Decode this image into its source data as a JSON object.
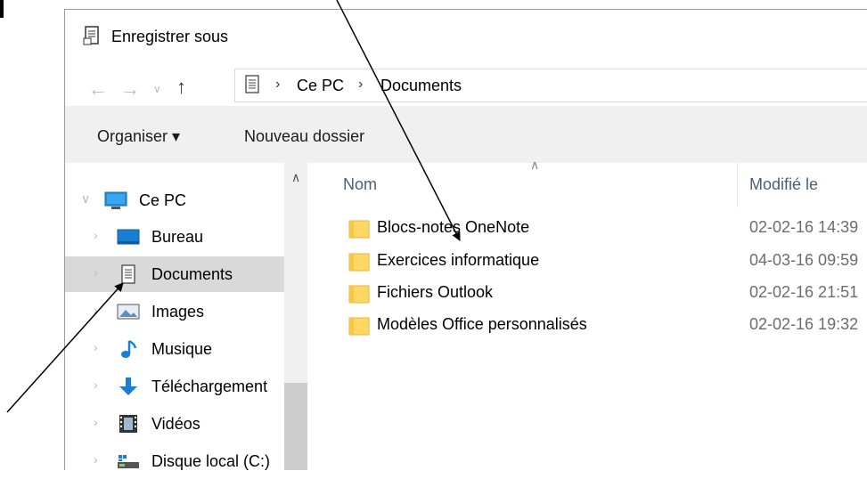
{
  "window": {
    "title": "Enregistrer sous",
    "title_icon": "document-save-icon"
  },
  "address": {
    "back_icon": "back-arrow-icon",
    "forward_icon": "forward-arrow-icon",
    "recent_icon": "chevron-down-icon",
    "up_icon": "up-arrow-icon",
    "location_icon": "documents-icon",
    "separator": "›",
    "crumbs": [
      "Ce PC",
      "Documents"
    ]
  },
  "toolbar": {
    "organize_label": "Organiser ▾",
    "new_folder_label": "Nouveau dossier"
  },
  "sidebar": {
    "items": [
      {
        "label": "Ce PC",
        "icon": "computer-icon",
        "selected": false
      },
      {
        "label": "Bureau",
        "icon": "desktop-icon",
        "selected": false
      },
      {
        "label": "Documents",
        "icon": "documents-icon",
        "selected": true
      },
      {
        "label": "Images",
        "icon": "images-icon",
        "selected": false
      },
      {
        "label": "Musique",
        "icon": "music-icon",
        "selected": false
      },
      {
        "label": "Téléchargement",
        "icon": "download-icon",
        "selected": false
      },
      {
        "label": "Vidéos",
        "icon": "video-icon",
        "selected": false
      },
      {
        "label": "Disque local (C:)",
        "icon": "drive-icon",
        "selected": false
      }
    ]
  },
  "filelist": {
    "headers": {
      "name": "Nom",
      "modified": "Modifié le"
    },
    "rows": [
      {
        "name": "Blocs-notes OneNote",
        "modified": "02-02-16 14:39"
      },
      {
        "name": "Exercices informatique",
        "modified": "04-03-16 09:59"
      },
      {
        "name": "Fichiers Outlook",
        "modified": "02-02-16 21:51"
      },
      {
        "name": "Modèles Office personnalisés",
        "modified": "02-02-16 19:32"
      }
    ]
  },
  "colors": {
    "folder": "#ffd761",
    "selected_row": "#d9d9d9",
    "toolbar_bg": "#f0f0f0",
    "header_text": "#4c607a"
  }
}
